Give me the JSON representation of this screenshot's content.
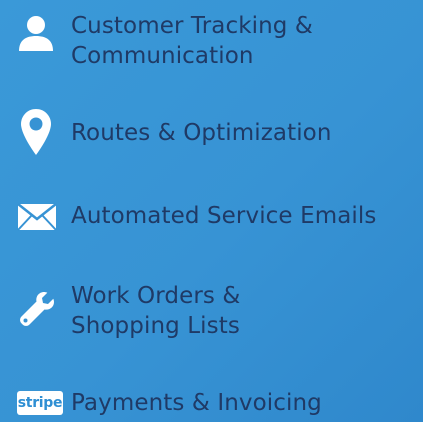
{
  "features": [
    {
      "icon": "user-icon",
      "lines": [
        "Customer Tracking &",
        "Communication"
      ]
    },
    {
      "icon": "map-pin-icon",
      "lines": [
        "Routes & Optimization"
      ]
    },
    {
      "icon": "envelope-icon",
      "lines": [
        "Automated Service Emails"
      ]
    },
    {
      "icon": "wrench-icon",
      "lines": [
        "Work Orders &",
        "Shopping Lists"
      ]
    },
    {
      "icon": "stripe-logo",
      "badge_text": "stripe",
      "lines": [
        "Payments & Invoicing"
      ]
    }
  ],
  "colors": {
    "background": "#3793d4",
    "label_text": "#1f3a66",
    "icon": "#ffffff"
  }
}
